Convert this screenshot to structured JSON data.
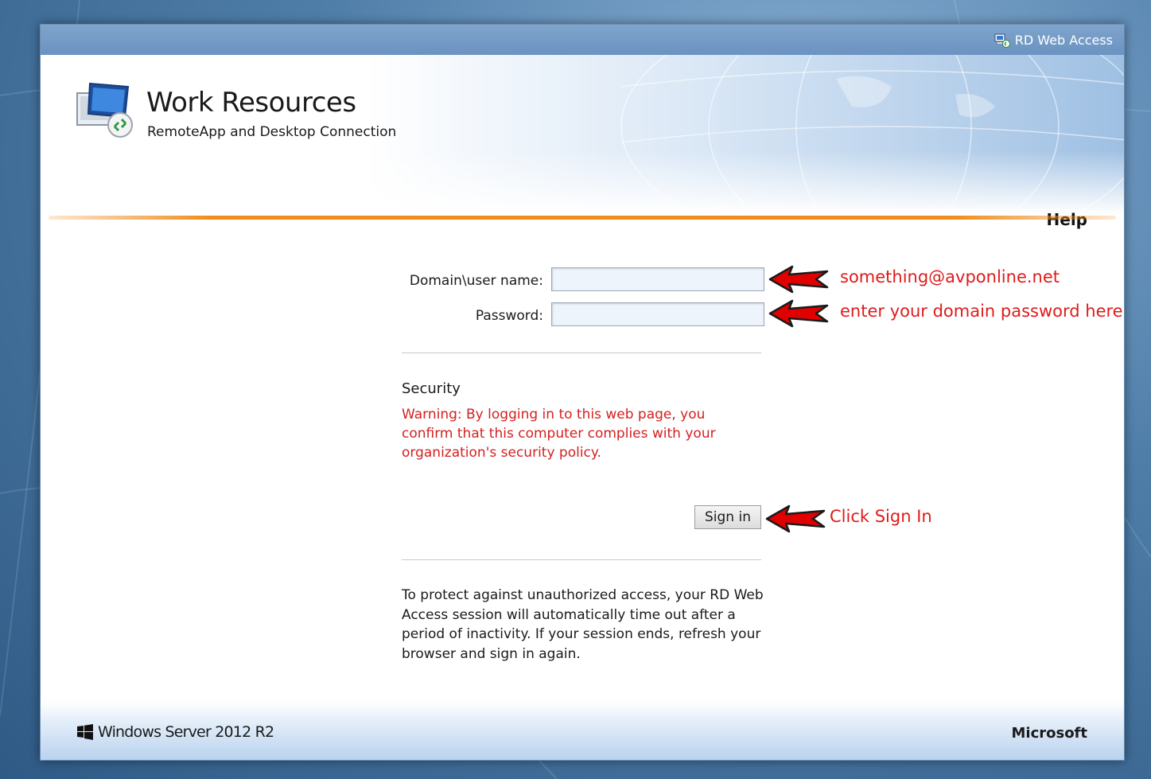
{
  "topbar": {
    "product_label": "RD Web Access"
  },
  "header": {
    "title": "Work Resources",
    "subtitle": "RemoteApp and Desktop Connection",
    "help_label": "Help"
  },
  "form": {
    "username_label": "Domain\\user name:",
    "username_value": "",
    "password_label": "Password:",
    "password_value": "",
    "signin_label": "Sign in"
  },
  "security": {
    "heading": "Security",
    "warning": "Warning: By logging in to this web page, you confirm that this computer complies with your organization's security policy."
  },
  "info_text": "To protect against unauthorized access, your RD Web Access session will automatically time out after a period of inactivity. If your session ends, refresh your browser and sign in again.",
  "footer": {
    "os_label": "Windows Server 2012 R2",
    "vendor_label": "Microsoft"
  },
  "annotations": {
    "username_hint": "something@avponline.net",
    "password_hint": "enter your domain password here",
    "signin_hint": "Click Sign In"
  },
  "colors": {
    "accent_orange": "#f18d1c",
    "warning_red": "#d42020",
    "annotation_red": "#e01b1b",
    "topbar_blue": "#6b93c1"
  }
}
